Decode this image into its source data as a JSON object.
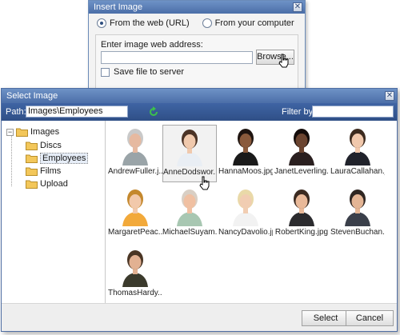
{
  "insert_dialog": {
    "title": "Insert Image",
    "radio_web": "From the web (URL)",
    "radio_computer": "From your computer",
    "address_label": "Enter image web address:",
    "address_value": "",
    "browse_label": "Browse...",
    "save_label": "Save file to server"
  },
  "select_dialog": {
    "title": "Select Image",
    "path_label": "Path:",
    "path_value": "Images\\Employees",
    "filter_label": "Filter by:",
    "filter_value": "",
    "tree": {
      "root": "Images",
      "children": [
        "Discs",
        "Employees",
        "Films",
        "Upload"
      ],
      "selected": "Employees"
    },
    "thumbnails": [
      {
        "name": "AndrewFuller.j...",
        "suit": "#9aa4a8",
        "skin": "#e6b9a0",
        "hair": "#c9c9c9"
      },
      {
        "name": "AnneDodswor...",
        "suit": "#e9eef4",
        "skin": "#f0c9ad",
        "hair": "#4b3326"
      },
      {
        "name": "HannaMoos.jpg",
        "suit": "#1a1a1a",
        "skin": "#8a5a3c",
        "hair": "#1e1410"
      },
      {
        "name": "JanetLeverling...",
        "suit": "#2a1f1f",
        "skin": "#6b4430",
        "hair": "#140c0a"
      },
      {
        "name": "LauraCallahan.j...",
        "suit": "#20222b",
        "skin": "#f1c8ac",
        "hair": "#3c2a1e"
      },
      {
        "name": "MargaretPeac...",
        "suit": "#f2a93a",
        "skin": "#f2c9ab",
        "hair": "#c4882d"
      },
      {
        "name": "MichaelSuyam...",
        "suit": "#a8c7b2",
        "skin": "#f0c0a2",
        "hair": "#d9cfc4"
      },
      {
        "name": "NancyDavolio.jpg",
        "suit": "#f2f2f2",
        "skin": "#f1cdb2",
        "hair": "#e9d9a8"
      },
      {
        "name": "RobertKing.jpg",
        "suit": "#2b2b2e",
        "skin": "#e9b999",
        "hair": "#3b2a20"
      },
      {
        "name": "StevenBuchan...",
        "suit": "#3a3f4a",
        "skin": "#e4b595",
        "hair": "#2f2622"
      },
      {
        "name": "ThomasHardy....",
        "suit": "#3b3a2c",
        "skin": "#e2b192",
        "hair": "#4a3524"
      }
    ],
    "selected_thumbnail": "AnneDodswor...",
    "select_button": "Select",
    "cancel_button": "Cancel"
  },
  "colors": {
    "titlebar": "#4b6ea8",
    "toolbar": "#2f4f86",
    "refresh": "#2e9e3a",
    "folder": "#f3c75a"
  }
}
